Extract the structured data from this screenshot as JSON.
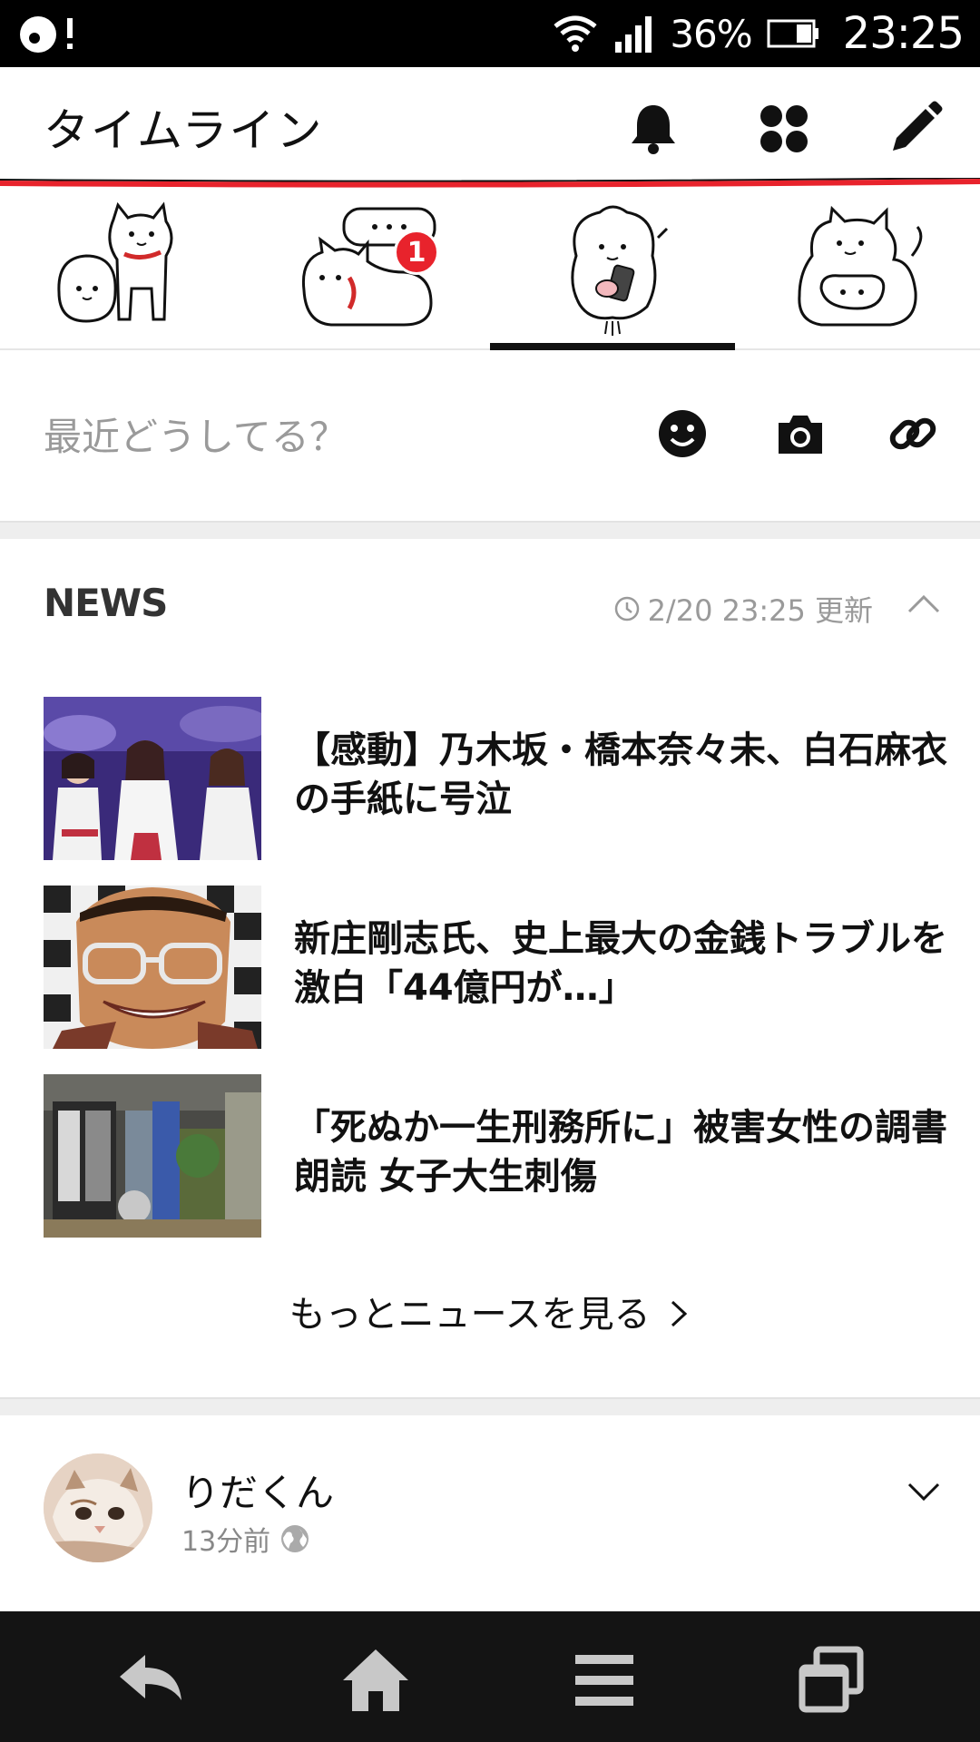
{
  "status_bar": {
    "battery_percent": "36%",
    "time": "23:25",
    "icons": [
      "app-notification-icon",
      "wifi-icon",
      "signal-icon",
      "battery-icon"
    ]
  },
  "header": {
    "title": "タイムライン",
    "icons": [
      "bell-icon",
      "apps-icon",
      "pencil-icon"
    ],
    "accent_color": "#e8232c"
  },
  "sticker_tabs": {
    "selected_index": 2,
    "items": [
      {
        "icon": "two-dogs-sticker-icon",
        "badge": ""
      },
      {
        "icon": "cat-speech-sticker-icon",
        "badge": "1"
      },
      {
        "icon": "fluffy-dog-phone-sticker-icon",
        "badge": ""
      },
      {
        "icon": "cat-hug-sticker-icon",
        "badge": ""
      }
    ]
  },
  "composer": {
    "placeholder": "最近どうしてる？",
    "icons": [
      "emoji-icon",
      "camera-icon",
      "link-icon"
    ]
  },
  "news": {
    "heading": "NEWS",
    "updated": "2/20 23:25 更新",
    "items": [
      {
        "headline": "【感動】乃木坂・橋本奈々未、白石麻衣の手紙に号泣"
      },
      {
        "headline": "新庄剛志氏、史上最大の金銭トラブルを激白「44億円が…」"
      },
      {
        "headline": "「死ぬか一生刑務所に」被害女性の調書朗読 女子大生刺傷"
      }
    ],
    "more_label": "もっとニュースを見る"
  },
  "post": {
    "author": "りだくん",
    "time": "13分前"
  },
  "nav_bar": {
    "icons": [
      "back-icon",
      "home-icon",
      "menu-icon",
      "recent-apps-icon"
    ]
  }
}
